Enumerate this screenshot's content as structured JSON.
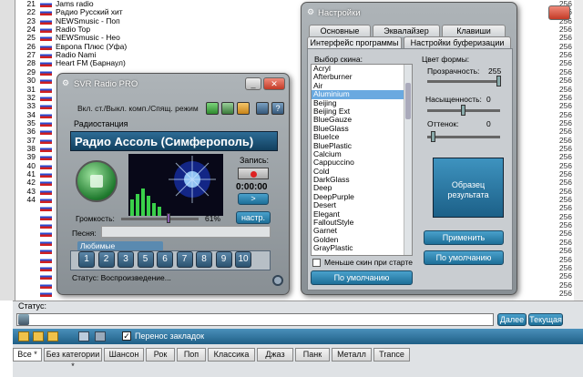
{
  "station_list": {
    "rows": [
      {
        "num": "21",
        "name": "Jams radio",
        "bitrate": "256"
      },
      {
        "num": "22",
        "name": "Радио Русский хит",
        "bitrate": "256"
      },
      {
        "num": "23",
        "name": "NEWSmusic - Поп",
        "bitrate": "256"
      },
      {
        "num": "24",
        "name": "Radio Top",
        "bitrate": "256"
      },
      {
        "num": "25",
        "name": "NEWSmusic - Нео",
        "bitrate": "256"
      },
      {
        "num": "26",
        "name": "Европа Плюс (Уфа)",
        "bitrate": "256"
      },
      {
        "num": "27",
        "name": "Radio Nami",
        "bitrate": "256"
      },
      {
        "num": "28",
        "name": "Heart FM (Барнаул)",
        "bitrate": "256"
      },
      {
        "num": "29",
        "name": "",
        "bitrate": "256"
      },
      {
        "num": "30",
        "name": "",
        "bitrate": "256"
      },
      {
        "num": "31",
        "name": "",
        "bitrate": "256"
      },
      {
        "num": "32",
        "name": "",
        "bitrate": "256"
      },
      {
        "num": "33",
        "name": "",
        "bitrate": "256"
      },
      {
        "num": "34",
        "name": "",
        "bitrate": "256"
      },
      {
        "num": "35",
        "name": "",
        "bitrate": "256"
      },
      {
        "num": "36",
        "name": "",
        "bitrate": "256"
      },
      {
        "num": "37",
        "name": "",
        "bitrate": "256"
      },
      {
        "num": "38",
        "name": "",
        "bitrate": "256"
      },
      {
        "num": "39",
        "name": "",
        "bitrate": "256"
      },
      {
        "num": "40",
        "name": "",
        "bitrate": "256"
      },
      {
        "num": "41",
        "name": "",
        "bitrate": "256"
      },
      {
        "num": "42",
        "name": "",
        "bitrate": "256"
      },
      {
        "num": "43",
        "name": "",
        "bitrate": "256"
      },
      {
        "num": "44",
        "name": "",
        "bitrate": "256"
      },
      {
        "num": "",
        "name": "",
        "bitrate": "256"
      },
      {
        "num": "",
        "name": "",
        "bitrate": "256"
      },
      {
        "num": "",
        "name": "",
        "bitrate": "256"
      },
      {
        "num": "",
        "name": "",
        "bitrate": "256"
      },
      {
        "num": "",
        "name": "",
        "bitrate": "256"
      },
      {
        "num": "",
        "name": "",
        "bitrate": "256"
      },
      {
        "num": "",
        "name": "",
        "bitrate": "256"
      },
      {
        "num": "",
        "name": "",
        "bitrate": "256"
      },
      {
        "num": "",
        "name": "",
        "bitrate": "256"
      },
      {
        "num": "",
        "name": "",
        "bitrate": "256"
      },
      {
        "num": "",
        "name": "",
        "bitrate": "256"
      }
    ]
  },
  "radio": {
    "title": "SVR Radio PRO",
    "toggle_label": "Вкл. ст./Выкл. комп./Спящ. режим",
    "station_label": "Радиостанция",
    "station_name": "Радио Ассоль (Симферополь)",
    "record_label": "Запись:",
    "time": "0:00:00",
    "next_label": ">",
    "settings_label": "настр.",
    "volume_label": "Громкость:",
    "volume_value": "61%",
    "volume_fraction": 0.61,
    "song_label": "Песня:",
    "favorites_label": "Любимые радиостанции:",
    "favorites": [
      "1",
      "2",
      "3",
      "5",
      "6",
      "7",
      "8",
      "9",
      "10"
    ],
    "status": "Статус: Воспроизведение..."
  },
  "settings": {
    "title": "Настройки",
    "tabs_row1": [
      "Основные",
      "Эквалайзер",
      "Клавиши"
    ],
    "tabs_row2": [
      "Интерфейс программы",
      "Настройки буферизации"
    ],
    "skin_label": "Выбор скина:",
    "skins": [
      "Acryl",
      "Afterburner",
      "Air",
      "Aluminium",
      "Beijing",
      "Beijing Ext",
      "BlueGauze",
      "BlueGlass",
      "BlueIce",
      "BluePlastic",
      "Calcium",
      "Cappuccino",
      "Cold",
      "DarkGlass",
      "Deep",
      "DeepPurple",
      "Desert",
      "Elegant",
      "FalloutStyle",
      "Garnet",
      "Golden",
      "GrayPlastic"
    ],
    "selected_skin": "Aluminium",
    "color_label": "Цвет формы:",
    "transparency_label": "Прозрачность:",
    "transparency_value": "255",
    "saturation_label": "Насыщенность:",
    "saturation_value": "0",
    "hue_label": "Оттенок:",
    "hue_value": "0",
    "sample_label": "Образец результата",
    "apply_label": "Применить",
    "default_label_right": "По умолчанию",
    "no_skin_label": "Меньше скин при старте",
    "default_label_left": "По умолчанию"
  },
  "bottom": {
    "status_label": "Статус:",
    "next_button": "Далее",
    "current_button": "Текущая",
    "wrap_label": "Перенос закладок",
    "tabs": [
      "Все *",
      "Без категории *",
      "Шансон",
      "Рок",
      "Поп",
      "Классика",
      "Джаз",
      "Панк",
      "Металл",
      "Trance"
    ]
  }
}
